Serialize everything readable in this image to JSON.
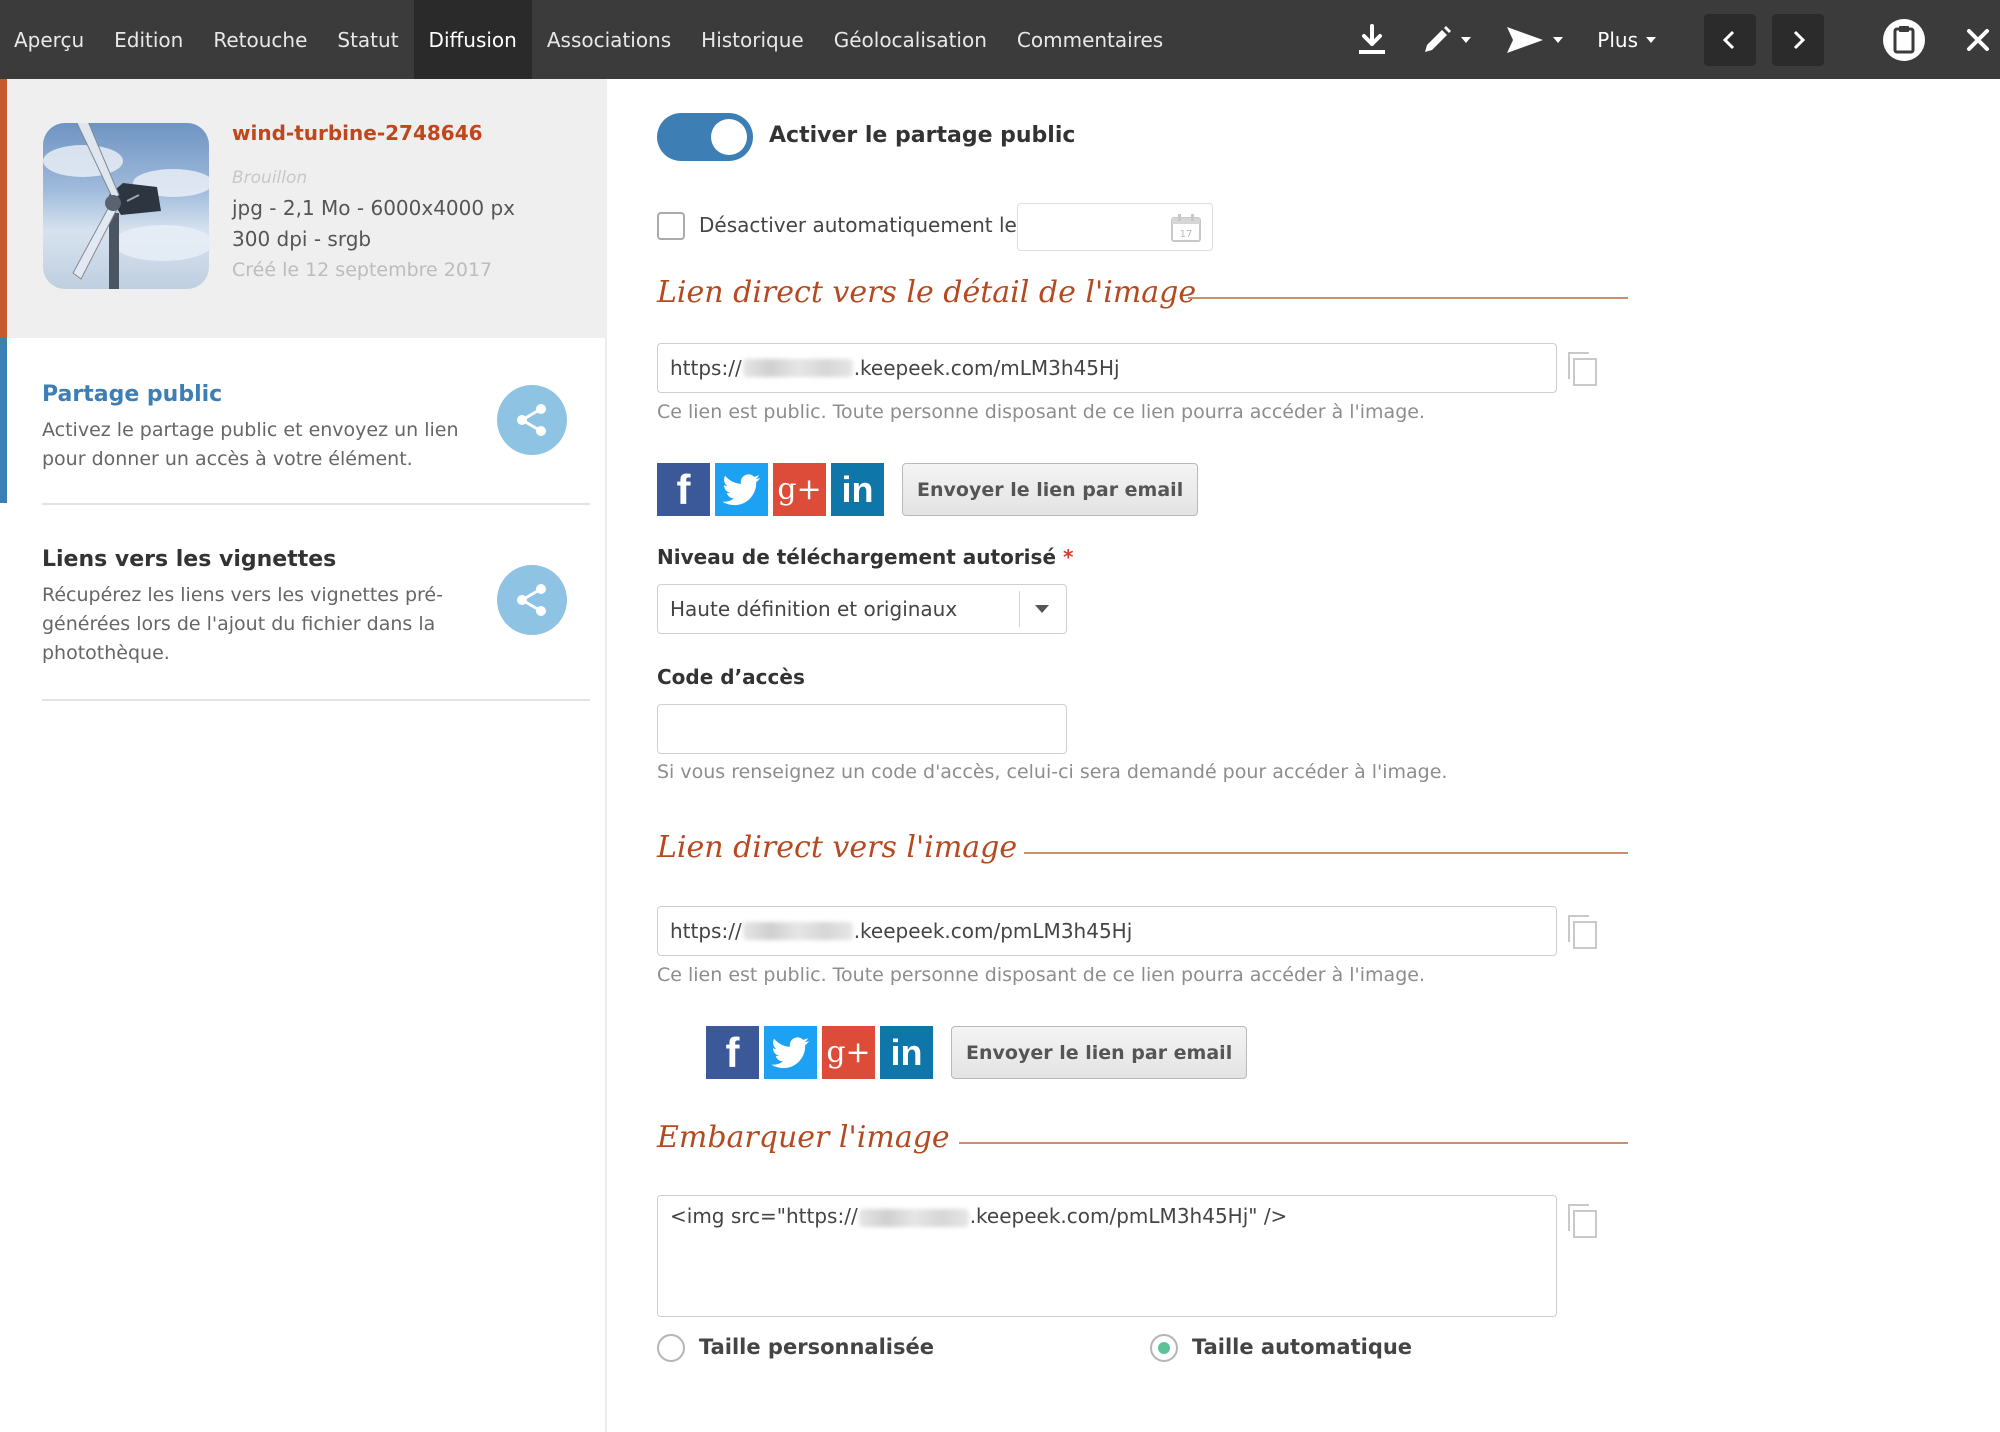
{
  "topbar": {
    "tabs": [
      {
        "label": "Aperçu"
      },
      {
        "label": "Edition"
      },
      {
        "label": "Retouche"
      },
      {
        "label": "Statut"
      },
      {
        "label": "Diffusion",
        "active": true
      },
      {
        "label": "Associations"
      },
      {
        "label": "Historique"
      },
      {
        "label": "Géolocalisation"
      },
      {
        "label": "Commentaires"
      }
    ],
    "more_label": "Plus",
    "icons": [
      "download-icon",
      "pencil-icon",
      "send-icon",
      "chevron-left-icon",
      "chevron-right-icon",
      "clipboard-icon",
      "close-icon"
    ]
  },
  "file": {
    "name": "wind-turbine-2748646",
    "status": "Brouillon",
    "meta_line1": "jpg - 2,1 Mo - 6000x4000 px",
    "meta_line2": "300 dpi - srgb",
    "created": "Créé le 12 septembre 2017"
  },
  "sidebar": {
    "items": [
      {
        "title": "Partage public",
        "desc": "Activez le partage public et envoyez un lien pour donner un accès à votre élément.",
        "active": true
      },
      {
        "title": "Liens vers les vignettes",
        "desc": "Récupérez les liens vers les vignettes pré-générées lors de l'ajout du fichier dans la photothèque."
      }
    ]
  },
  "main": {
    "toggle_label": "Activer le partage public",
    "toggle_on": true,
    "auto_disable_label": "Désactiver automatiquement le",
    "section_detail": {
      "title": "Lien direct vers le détail de l'image",
      "url_prefix": "https://",
      "url_suffix": ".keepeek.com/mLM3h45Hj",
      "hint": "Ce lien est public. Toute personne disposant de ce lien pourra accéder à l'image.",
      "email_button": "Envoyer le lien par email"
    },
    "download_level": {
      "label": "Niveau de téléchargement autorisé",
      "required_mark": "*",
      "value": "Haute définition et originaux"
    },
    "access_code": {
      "label": "Code d’accès",
      "value": "",
      "hint": "Si vous renseignez un code d'accès, celui-ci sera demandé pour accéder à l'image."
    },
    "section_image": {
      "title": "Lien direct vers l'image",
      "url_prefix": "https://",
      "url_suffix": ".keepeek.com/pmLM3h45Hj",
      "hint": "Ce lien est public. Toute personne disposant de ce lien pourra accéder à l'image.",
      "email_button": "Envoyer le lien par email"
    },
    "section_embed": {
      "title": "Embarquer l'image",
      "code_prefix": "<img src=\"https://",
      "code_suffix": ".keepeek.com/pmLM3h45Hj\" />",
      "size_custom": "Taille personnalisée",
      "size_auto": "Taille automatique",
      "selected": "auto"
    },
    "social": {
      "facebook": "f",
      "twitter": "twitter-bird-icon",
      "google": "g+",
      "linkedin": "in"
    }
  },
  "colors": {
    "accent_blue": "#3d7fb4",
    "accent_orange": "#c0461b",
    "radio_green": "#5cc29a"
  }
}
